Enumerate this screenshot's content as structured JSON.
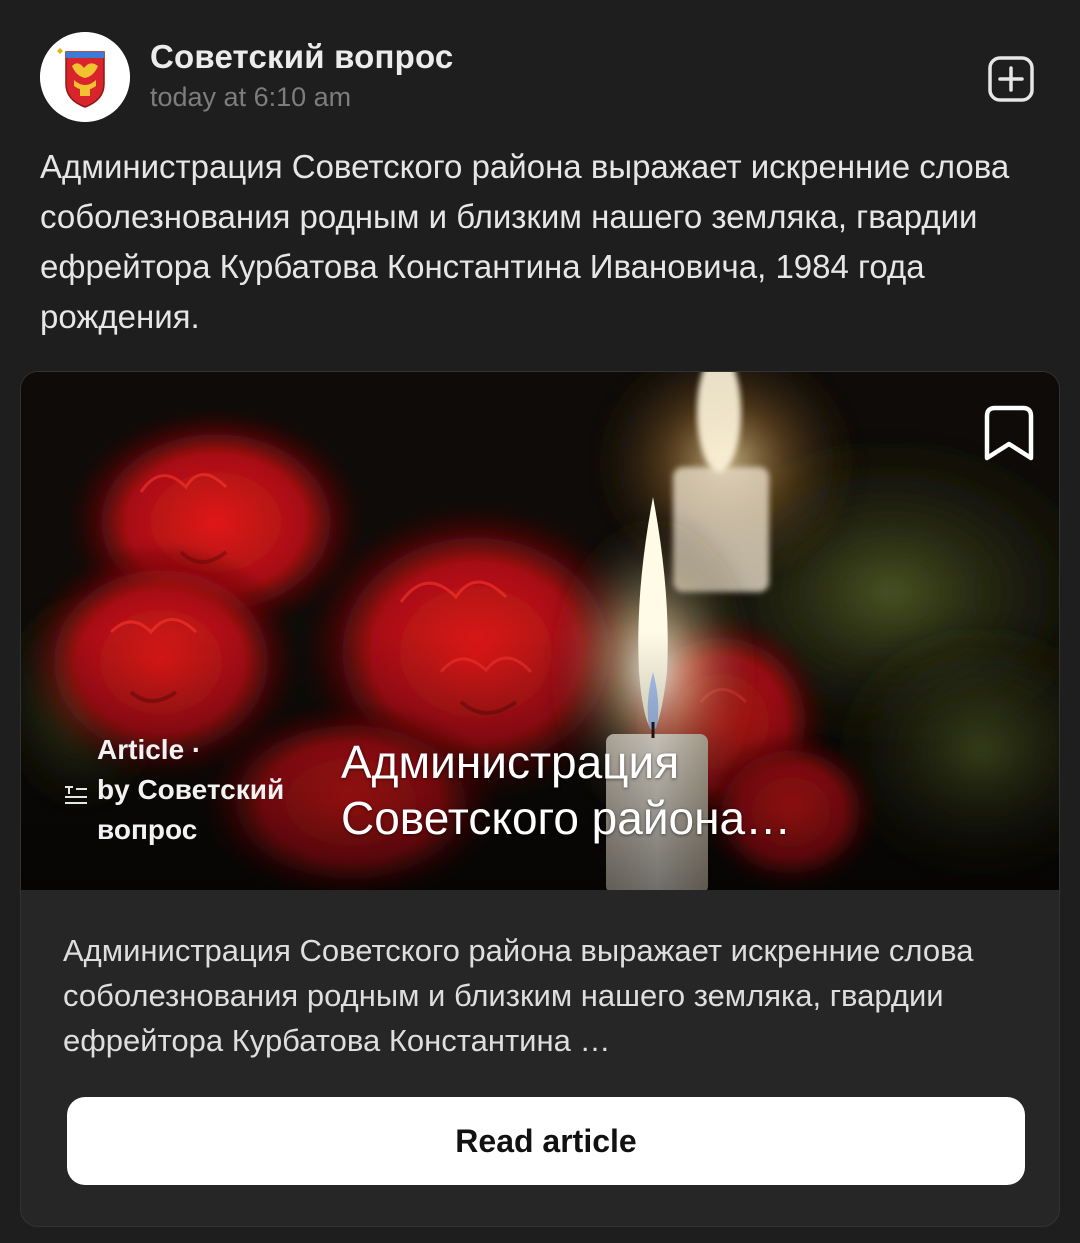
{
  "channel": {
    "name": "Советский вопрос",
    "time": "today at 6:10 am",
    "avatar_icon": "coat-of-arms-icon"
  },
  "header_actions": {
    "add_icon": "plus-square-icon"
  },
  "post": {
    "text": "Администрация Советского района выражает искренние слова соболезнования родным и близким нашего земляка, гвардии ефрейтора Курбатова Константина Ивановича, 1984 года рождения."
  },
  "article_card": {
    "meta_line1": "Article ·",
    "meta_line2": "by Советский",
    "meta_line3": "вопрос",
    "title_line1": "Администрация",
    "title_line2": "Советского района…",
    "excerpt": "Администрация Советского района выражает искренние слова соболезнования родным и близким нашего земляка, гвардии ефрейтора Курбатова Константина …",
    "read_button": "Read article",
    "bookmark_icon": "bookmark-icon",
    "article_icon": "article-list-icon"
  },
  "colors": {
    "background": "#1e1e1e",
    "card_background": "#262626",
    "button_background": "#ffffff",
    "flower_red": "#c4141a"
  }
}
